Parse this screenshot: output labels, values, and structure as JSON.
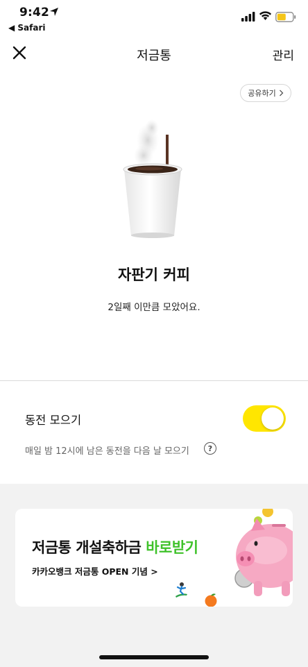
{
  "status_bar": {
    "time": "9:42",
    "back_label": "◀ Safari",
    "battery_color": "#f5c518"
  },
  "nav": {
    "title": "저금통",
    "manage_label": "관리"
  },
  "share_label": "공유하기",
  "goal": {
    "title": "자판기 커피",
    "subtitle": "2일째 이만큼 모았어요."
  },
  "coin_setting": {
    "label": "동전 모으기",
    "enabled": true,
    "description": "매일 밤 12시에 남은 동전을 다음 날 모으기",
    "help_glyph": "?"
  },
  "banner": {
    "title_prefix": "저금통 개설축하금 ",
    "title_highlight": "바로받기",
    "subtitle": "카카오뱅크 저금통 OPEN 기념 >"
  },
  "colors": {
    "accent_yellow": "#ffe600",
    "highlight_green": "#3fc22a",
    "background_gray": "#f2f2f2"
  }
}
